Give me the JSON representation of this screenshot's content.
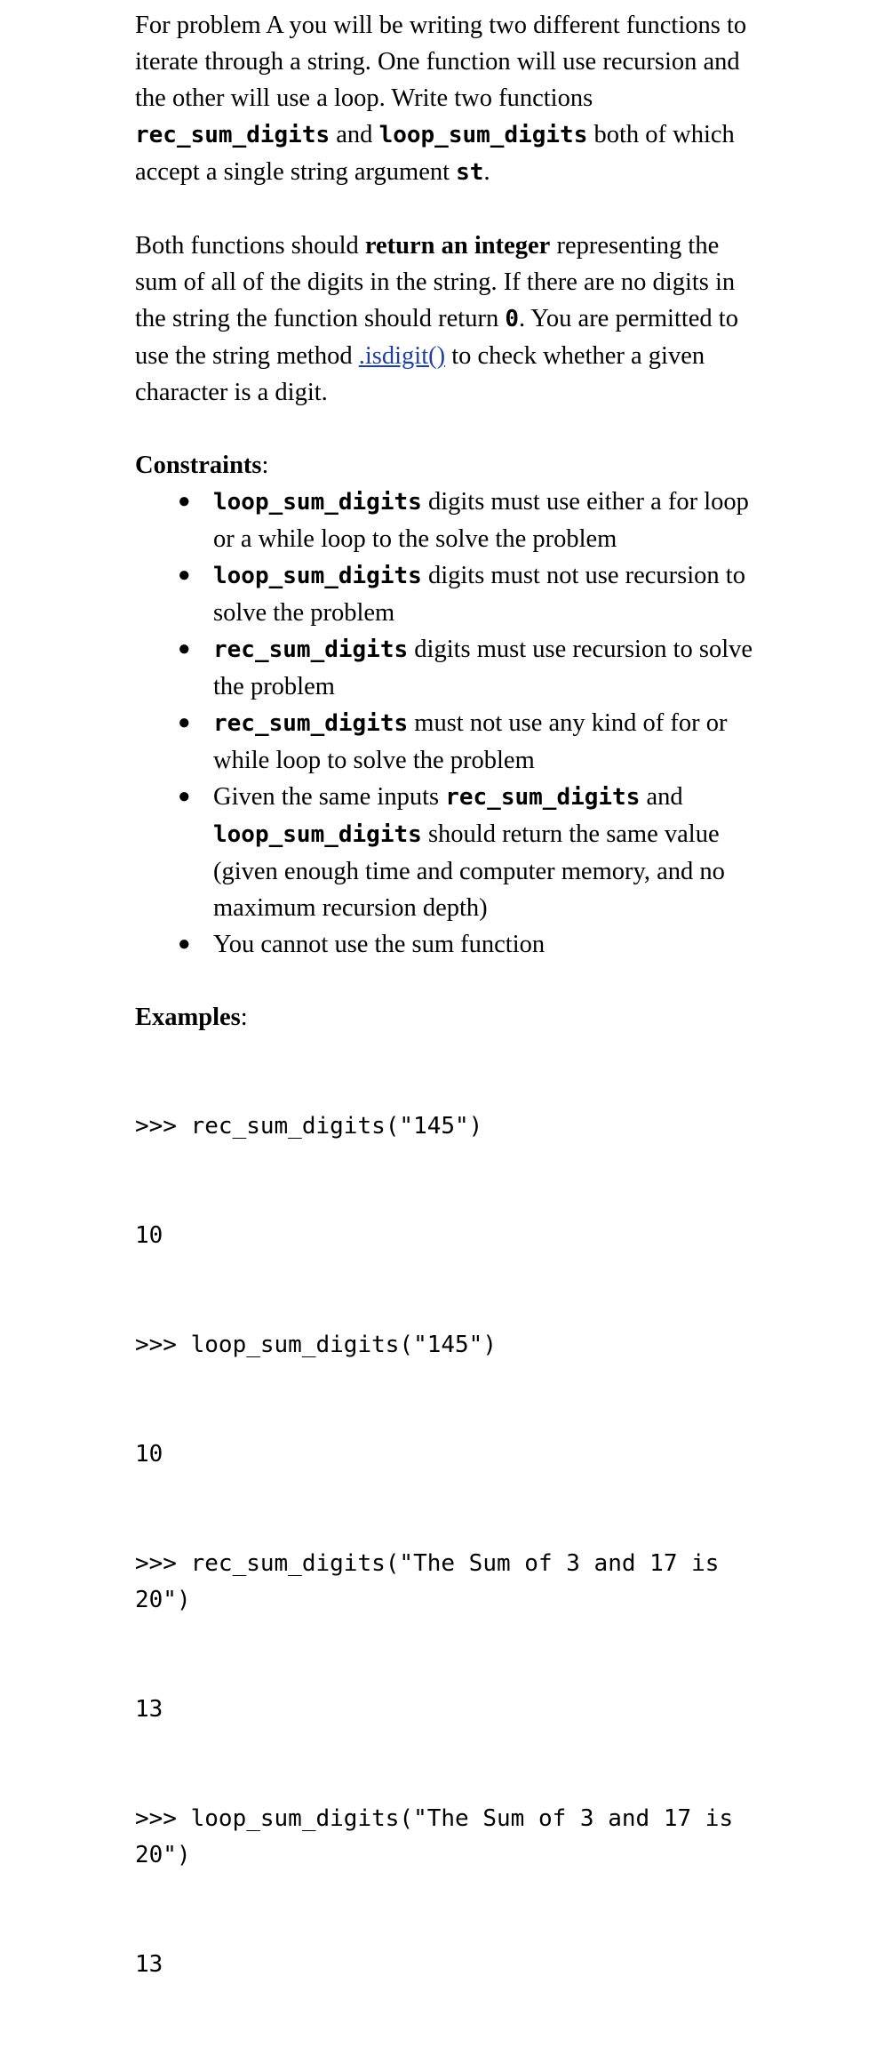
{
  "document": {
    "intro": {
      "text_1": "For problem A you will be writing two different functions to iterate through a string. One function will use recursion and the other will use a loop. Write two functions ",
      "code_1": "rec_sum_digits",
      "text_2": " and ",
      "code_2": "loop_sum_digits",
      "text_3": " both of which accept a single string argument ",
      "code_3": "st",
      "text_4": "."
    },
    "requirements": {
      "text_1": "Both functions should  ",
      "bold_1": "return an integer",
      "text_2": " representing the sum of all of the digits in the string.  If there are no digits in the string the function should return ",
      "code_1": "0",
      "text_3": ".  You are permitted to use the string method ",
      "link_1": ".isdigit()",
      "text_4": " to check whether a given character is a digit."
    },
    "constraints": {
      "heading": "Constraints",
      "heading_colon": ":",
      "bullet_glyph": "●",
      "items": [
        {
          "code_1": "loop_sum_digits",
          "text_1": "  digits must use either a for loop or a while loop to the solve the problem"
        },
        {
          "code_1": "loop_sum_digits",
          "text_1": "  digits must not use recursion to solve the problem"
        },
        {
          "code_1": "rec_sum_digits",
          "text_1": "  digits must use recursion to solve the problem"
        },
        {
          "code_1": "rec_sum_digits",
          "text_1": "  must not use any kind of for or while loop to solve the problem"
        },
        {
          "text_0": "Given the same inputs  ",
          "code_1": "rec_sum_digits",
          "text_1": " and ",
          "code_2": "loop_sum_digits",
          "text_2": " should return the same value (given enough time and computer memory, and no maximum recursion depth)"
        },
        {
          "text_0": "You cannot use the sum function"
        }
      ]
    },
    "examples": {
      "heading": "Examples",
      "heading_colon": ":",
      "lines": [
        ">>> rec_sum_digits(\"145\")",
        "10",
        ">>> loop_sum_digits(\"145\")",
        "10",
        ">>> rec_sum_digits(\"The Sum of 3 and 17 is 20\")",
        "13",
        ">>> loop_sum_digits(\"The Sum of 3 and 17 is 20\")",
        "13"
      ]
    }
  },
  "colors": {
    "text": "#000000",
    "link": "#1f3fa0",
    "background": "#ffffff"
  }
}
